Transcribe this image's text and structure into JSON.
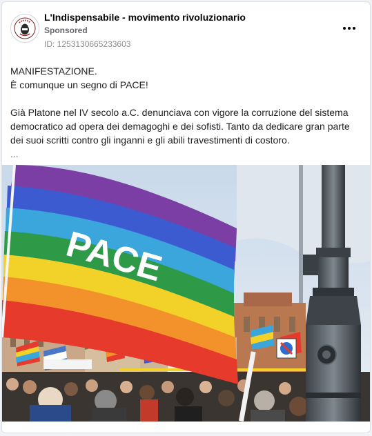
{
  "post": {
    "page_name": "L'Indispensabile - movimento rivoluzionario",
    "sponsored_label": "Sponsored",
    "post_id": "ID: 1253130665233603",
    "more_icon": "more-horizontal-icon",
    "text": {
      "line1": "MANIFESTAZIONE.",
      "line2": "È comunque un segno di PACE!",
      "line3": "Già Platone nel IV secolo a.C. denunciava con vigore la corruzione del sistema",
      "line4": "democratico ad opera dei demagoghi e dei sofisti. Tanto da dedicare gran parte",
      "line5": "dei suoi scritti contro gli inganni e gli abili travestimenti di costoro.",
      "see_more": "..."
    },
    "image": {
      "flag_text": "PACE",
      "stripe_colors": [
        "#7a3ea5",
        "#3c5bd0",
        "#3aa6dc",
        "#2e9a48",
        "#f2d129",
        "#f3912a",
        "#e53a2c"
      ]
    }
  }
}
